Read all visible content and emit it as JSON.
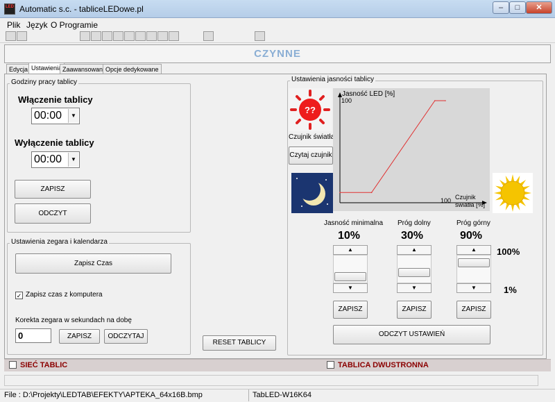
{
  "window": {
    "title": "Automatic s.c. - tabliceLEDowe.pl",
    "icon_text": "LED",
    "minimize": "–",
    "maximize": "□",
    "close": "✕"
  },
  "menu": [
    "Plik",
    "Język",
    "O Programie"
  ],
  "status_header": "CZYNNE",
  "tabs": [
    "Edycja",
    "Ustawienia",
    "Zaawansowane",
    "Opcje dedykowane"
  ],
  "work_hours": {
    "title": "Godziny pracy tablicy",
    "on_label": "Włączenie tablicy",
    "on_value": "00:00",
    "off_label": "Wyłączenie tablicy",
    "off_value": "00:00",
    "save_label": "ZAPISZ",
    "read_label": "ODCZYT"
  },
  "clock": {
    "title": "Ustawienia zegara i kalendarza",
    "save_time_label": "Zapisz Czas",
    "use_pc_time_label": "Zapisz czas z komputera",
    "use_pc_time_checked": "✓",
    "correction_label": "Korekta zegara w sekundach na dobę",
    "correction_value": "0",
    "save_label": "ZAPISZ",
    "read_label": "ODCZYTAJ"
  },
  "reset_label": "RESET TABLICY",
  "brightness": {
    "title": "Ustawienia jasności tablicy",
    "sensor_question": "??",
    "sensor_label": "Czujnik światła",
    "read_sensor_label": "Czytaj czujnik",
    "chart_ylabel": "Jasność LED [%]",
    "chart_ytick": "100",
    "chart_xtick": "100",
    "chart_xlabel_1": "Czujnik",
    "chart_xlabel_2": "światła [%]",
    "min_label": "Jasność minimalna",
    "min_value": "10%",
    "low_label": "Próg dolny",
    "low_value": "30%",
    "high_label": "Próg górny",
    "high_value": "90%",
    "scale_top": "100%",
    "scale_bottom": "1%",
    "save_label": "ZAPISZ",
    "read_settings_label": "ODCZYT USTAWIEŃ",
    "colors": {
      "curve": "#e03030",
      "chart_bg": "#d8d8d8",
      "sun": "#f5c400",
      "night": "#1b3570"
    }
  },
  "chart_data": {
    "type": "line",
    "x": [
      0,
      30,
      90,
      100
    ],
    "y": [
      10,
      10,
      100,
      100
    ],
    "xlim": [
      0,
      100
    ],
    "ylim": [
      0,
      100
    ]
  },
  "bottom": {
    "network_label": "SIEĆ TABLIC",
    "dual_label": "TABLICA DWUSTRONNA"
  },
  "statusbar": {
    "file": "File : D:\\Projekty\\LEDTAB\\EFEKTY\\APTEKA_64x16B.bmp",
    "device": "TabLED-W16K64"
  }
}
